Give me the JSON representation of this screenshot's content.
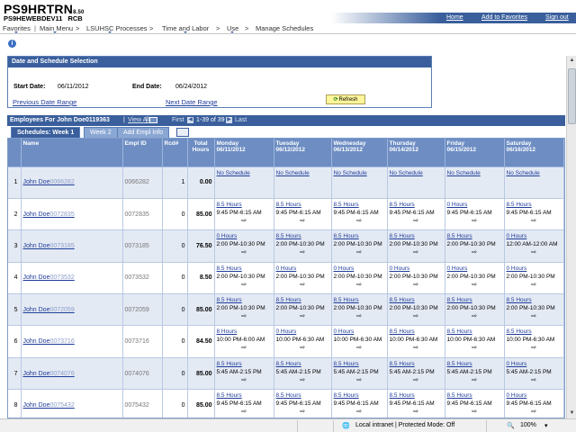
{
  "header": {
    "system_name": "PS9HRTRN",
    "system_version": "8.50",
    "db_name": "PS9HEWEBDEV11",
    "db_suffix": "RCB",
    "links": [
      "Home",
      "Add to Favorites",
      "Sign out"
    ]
  },
  "breadcrumb": [
    "Favorites",
    "Main Menu",
    ">",
    "LSUHSC Processes",
    ">",
    "Time and Labor",
    ">",
    "Use",
    ">",
    "Manage Schedules"
  ],
  "date_selection": {
    "title": "Date and Schedule Selection",
    "start_label": "Start Date:",
    "start_value": "06/11/2012",
    "end_label": "End Date:",
    "end_value": "06/24/2012",
    "prev_link": "Previous Date Range",
    "next_link": "Next Date Range",
    "refresh_label": "Refresh"
  },
  "employees_bar": {
    "title": "Employees For John Doe0119363",
    "separator": "|",
    "view_all": "View All",
    "first": "First",
    "range": "1-39 of 39",
    "last": "Last"
  },
  "tabs": [
    "Schedules: Week 1",
    "Week 2",
    "Add Empl Info"
  ],
  "columns": {
    "name": "Name",
    "emplid": "Empl ID",
    "rcd": "Rcd#",
    "total": "Total Hours",
    "days": [
      {
        "dow": "Monday",
        "date": "06/11/2012"
      },
      {
        "dow": "Tuesday",
        "date": "06/12/2012"
      },
      {
        "dow": "Wednesday",
        "date": "06/13/2012"
      },
      {
        "dow": "Thursday",
        "date": "06/14/2012"
      },
      {
        "dow": "Friday",
        "date": "06/15/2012"
      },
      {
        "dow": "Saturday",
        "date": "06/16/2012"
      }
    ]
  },
  "rows": [
    {
      "num": "1",
      "name": "John Doe",
      "name_id": "0066282",
      "emplid": "0066282",
      "rcd": "1",
      "total": "0.00",
      "days": [
        {
          "sched": "No Schedule"
        },
        {
          "sched": "No Schedule"
        },
        {
          "sched": "No Schedule"
        },
        {
          "sched": "No Schedule"
        },
        {
          "sched": "No Schedule"
        },
        {
          "sched": "No Schedule"
        }
      ]
    },
    {
      "num": "2",
      "name": "John Doe",
      "name_id": "0072835",
      "emplid": "0072835",
      "rcd": "0",
      "total": "85.00",
      "days": [
        {
          "sched": "8.5 Hours",
          "time": "9:45 PM-6:15 AM"
        },
        {
          "sched": "8.5 Hours",
          "time": "9:45 PM-6:15 AM"
        },
        {
          "sched": "8.5 Hours",
          "time": "9:45 PM-6:15 AM"
        },
        {
          "sched": "8.5 Hours",
          "time": "9:45 PM-6:15 AM"
        },
        {
          "sched": "0 Hours",
          "time": "9:45 PM-6:15 AM"
        },
        {
          "sched": "8.5 Hours",
          "time": "9:45 PM-6:15 AM"
        }
      ]
    },
    {
      "num": "3",
      "name": "John Doe",
      "name_id": "0073185",
      "emplid": "0073185",
      "rcd": "0",
      "total": "76.50",
      "days": [
        {
          "sched": "0 Hours",
          "time": "2:00 PM-10:30 PM"
        },
        {
          "sched": "8.5 Hours",
          "time": "2:00 PM-10:30 PM"
        },
        {
          "sched": "8.5 Hours",
          "time": "2:00 PM-10:30 PM"
        },
        {
          "sched": "8.5 Hours",
          "time": "2:00 PM-10:30 PM"
        },
        {
          "sched": "8.5 Hours",
          "time": "2:00 PM-10:30 PM"
        },
        {
          "sched": "0 Hours",
          "time": "12:00 AM-12:00 AM"
        }
      ]
    },
    {
      "num": "4",
      "name": "John Doe",
      "name_id": "0073532",
      "emplid": "0073532",
      "rcd": "0",
      "total": "8.50",
      "days": [
        {
          "sched": "8.5 Hours",
          "time": "2:00 PM-10:30 PM"
        },
        {
          "sched": "0 Hours",
          "time": "2:00 PM-10:30 PM"
        },
        {
          "sched": "0 Hours",
          "time": "2:00 PM-10:30 PM"
        },
        {
          "sched": "0 Hours",
          "time": "2:00 PM-10:30 PM"
        },
        {
          "sched": "0 Hours",
          "time": "2:00 PM-10:30 PM"
        },
        {
          "sched": "0 Hours",
          "time": "2:00 PM-10:30 PM"
        }
      ]
    },
    {
      "num": "5",
      "name": "John Doe",
      "name_id": "0072059",
      "emplid": "0072059",
      "rcd": "0",
      "total": "85.00",
      "days": [
        {
          "sched": "8.5 Hours",
          "time": "2:00 PM-10:30 PM"
        },
        {
          "sched": "8.5 Hours",
          "time": "2:00 PM-10:30 PM"
        },
        {
          "sched": "8.5 Hours",
          "time": "2:00 PM-10:30 PM"
        },
        {
          "sched": "8.5 Hours",
          "time": "2:00 PM-10:30 PM"
        },
        {
          "sched": "8.5 Hours",
          "time": "2:00 PM-10:30 PM"
        },
        {
          "sched": "8.5 Hours",
          "time": "2:00 PM-10:30 PM"
        }
      ]
    },
    {
      "num": "6",
      "name": "John Doe",
      "name_id": "0073716",
      "emplid": "0073716",
      "rcd": "0",
      "total": "84.50",
      "days": [
        {
          "sched": "8 Hours",
          "time": "10:00 PM-6:00 AM"
        },
        {
          "sched": "0 Hours",
          "time": "10:00 PM-6:30 AM"
        },
        {
          "sched": "0 Hours",
          "time": "10:00 PM-6:30 AM"
        },
        {
          "sched": "8.5 Hours",
          "time": "10:00 PM-6:30 AM"
        },
        {
          "sched": "8.5 Hours",
          "time": "10:00 PM-6:30 AM"
        },
        {
          "sched": "8.5 Hours",
          "time": "10:00 PM-6:30 AM"
        }
      ]
    },
    {
      "num": "7",
      "name": "John Doe",
      "name_id": "0074076",
      "emplid": "0074076",
      "rcd": "0",
      "total": "85.00",
      "days": [
        {
          "sched": "8.5 Hours",
          "time": "5:45 AM-2:15 PM"
        },
        {
          "sched": "8.5 Hours",
          "time": "5:45 AM-2:15 PM"
        },
        {
          "sched": "8.5 Hours",
          "time": "5:45 AM-2:15 PM"
        },
        {
          "sched": "8.5 Hours",
          "time": "5:45 AM-2:15 PM"
        },
        {
          "sched": "8.5 Hours",
          "time": "5:45 AM-2:15 PM"
        },
        {
          "sched": "0 Hours",
          "time": "5:45 AM-2:15 PM"
        }
      ]
    },
    {
      "num": "8",
      "name": "John Doe",
      "name_id": "0075432",
      "emplid": "0075432",
      "rcd": "0",
      "total": "85.00",
      "days": [
        {
          "sched": "8.5 Hours",
          "time": "9:45 PM-6:15 AM"
        },
        {
          "sched": "8.5 Hours",
          "time": "9:45 PM-6:15 AM"
        },
        {
          "sched": "8.5 Hours",
          "time": "9:45 PM-6:15 AM"
        },
        {
          "sched": "8.5 Hours",
          "time": "9:45 PM-6:15 AM"
        },
        {
          "sched": "8.5 Hours",
          "time": "9:45 PM-6:15 AM"
        },
        {
          "sched": "0 Hours",
          "time": "9:45 PM-6:15 AM"
        }
      ]
    }
  ],
  "status_bar": {
    "zone": "Local intranet | Protected Mode: Off",
    "zoom": "100%"
  },
  "icons": {
    "info": "info-icon",
    "refresh": "refresh-icon",
    "detail_arrow": "arrow-right-icon"
  }
}
